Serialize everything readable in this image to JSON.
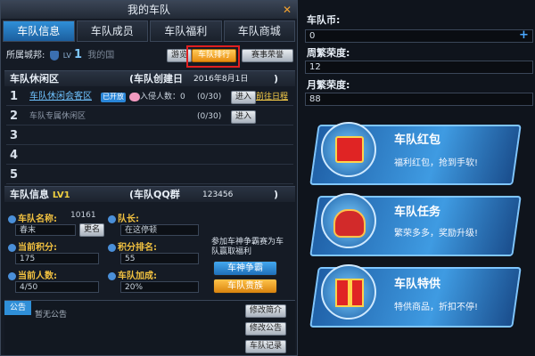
{
  "window": {
    "title": "我的车队",
    "close_glyph": "✕"
  },
  "tabs": [
    {
      "label": "车队信息",
      "active": true
    },
    {
      "label": "车队成员",
      "active": false
    },
    {
      "label": "车队福利",
      "active": false
    },
    {
      "label": "车队商城",
      "active": false
    }
  ],
  "city": {
    "label": "所属城邦:",
    "lv_prefix": "LV",
    "lv_num": "1",
    "name": "我的国"
  },
  "top_buttons": {
    "visit": "游览",
    "ranking": "车队排行",
    "honor": "赛事荣誉"
  },
  "lounge": {
    "header": "车队休闲区",
    "created": "(车队创建日",
    "created_date": "2016年8月1日",
    "paren_close": ")",
    "rows": [
      {
        "num": "1",
        "name": "车队休闲会客区",
        "tag": "已开放",
        "invite": "入侵人数：0",
        "count": "(0/30)",
        "enter": "进入",
        "goto": "前往日程"
      },
      {
        "num": "2",
        "name": "车队专属休闲区",
        "count": "(0/30)",
        "enter": "进入"
      },
      {
        "num": "3"
      },
      {
        "num": "4"
      },
      {
        "num": "5"
      }
    ]
  },
  "info": {
    "header": "车队信息",
    "lv": "LV1",
    "qq_label": "(车队QQ群",
    "qq": "123456",
    "paren_close": ")",
    "name_label": "车队名称:",
    "id": "10161",
    "name": "春末",
    "rename": "更名",
    "leader_label": "队长:",
    "leader": "在这停顿",
    "points_label": "当前积分:",
    "points": "175",
    "rank_label": "积分排名:",
    "rank": "55",
    "members_label": "当前人数:",
    "members": "4/50",
    "bonus_label": "车队加成:",
    "bonus": "20%",
    "battle_note": "参加车神争霸赛为车队赢取福利",
    "battle_btn": "车神争霸",
    "noble_btn": "车队贵族"
  },
  "announcement": {
    "corner": "公告",
    "text": "暂无公告",
    "edit_intro": "修改简介",
    "edit_notice": "修改公告",
    "log": "车队记录"
  },
  "right": {
    "coin_label": "车队币:",
    "coin": "0",
    "plus": "+",
    "weekly_label": "周繁荣度:",
    "weekly": "12",
    "monthly_label": "月繁荣度:",
    "monthly": "88",
    "cards": [
      {
        "title": "车队红包",
        "sub": "福利红包，抢到手软!",
        "icon": "red-envelope-icon"
      },
      {
        "title": "车队任务",
        "sub": "繁荣多多，奖励升级!",
        "icon": "lucky-bag-icon"
      },
      {
        "title": "车队特供",
        "sub": "特供商品，折扣不停!",
        "icon": "gift-box-icon"
      }
    ]
  },
  "colors": {
    "accent_blue": "#2f8fd8",
    "highlight_red": "#e02020",
    "orange": "#e78d10"
  }
}
